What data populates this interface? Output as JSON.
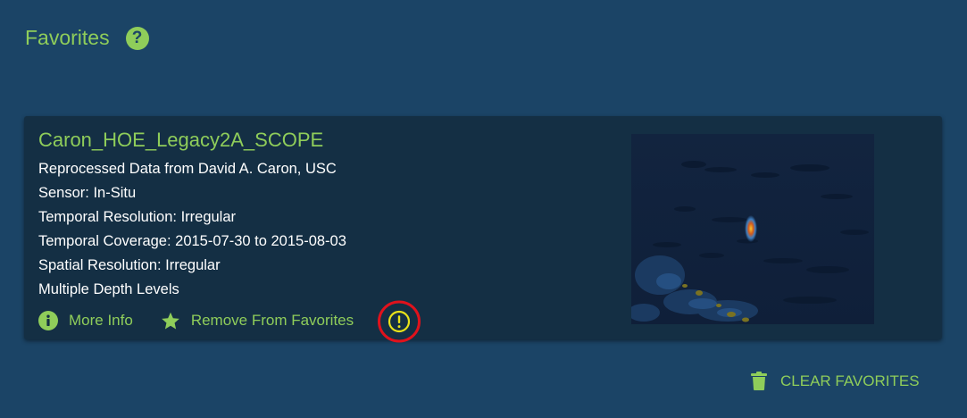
{
  "header": {
    "title": "Favorites",
    "help_icon": "?"
  },
  "card": {
    "title": "Caron_HOE_Legacy2A_SCOPE",
    "details": [
      "Reprocessed Data from David A. Caron, USC",
      "Sensor: In-Situ",
      "Temporal Resolution: Irregular",
      "Temporal Coverage: 2015-07-30 to 2015-08-03",
      "Spatial Resolution: Irregular",
      "Multiple Depth Levels"
    ],
    "actions": {
      "more_info": "More Info",
      "remove_favorite": "Remove From Favorites"
    },
    "icons": {
      "more_info": "info-icon",
      "remove_favorite": "star-icon",
      "warning": "exclamation-circle-icon"
    }
  },
  "footer": {
    "clear_label": "CLEAR FAVORITES",
    "clear_icon": "trash-icon"
  },
  "colors": {
    "background": "#1b4466",
    "card": "#142f44",
    "accent": "#8fcd5a",
    "highlight_ring": "#e0121c",
    "warning": "#e8e21a"
  }
}
